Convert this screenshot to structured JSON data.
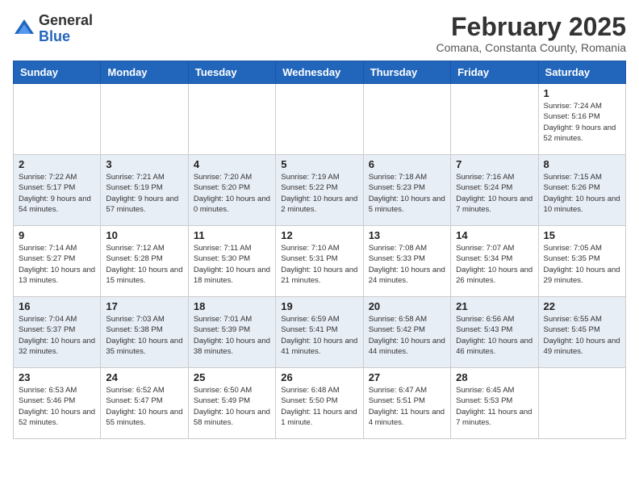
{
  "header": {
    "logo_general": "General",
    "logo_blue": "Blue",
    "month_year": "February 2025",
    "location": "Comana, Constanta County, Romania"
  },
  "weekdays": [
    "Sunday",
    "Monday",
    "Tuesday",
    "Wednesday",
    "Thursday",
    "Friday",
    "Saturday"
  ],
  "weeks": [
    [
      {
        "day": "",
        "info": ""
      },
      {
        "day": "",
        "info": ""
      },
      {
        "day": "",
        "info": ""
      },
      {
        "day": "",
        "info": ""
      },
      {
        "day": "",
        "info": ""
      },
      {
        "day": "",
        "info": ""
      },
      {
        "day": "1",
        "info": "Sunrise: 7:24 AM\nSunset: 5:16 PM\nDaylight: 9 hours and 52 minutes."
      }
    ],
    [
      {
        "day": "2",
        "info": "Sunrise: 7:22 AM\nSunset: 5:17 PM\nDaylight: 9 hours and 54 minutes."
      },
      {
        "day": "3",
        "info": "Sunrise: 7:21 AM\nSunset: 5:19 PM\nDaylight: 9 hours and 57 minutes."
      },
      {
        "day": "4",
        "info": "Sunrise: 7:20 AM\nSunset: 5:20 PM\nDaylight: 10 hours and 0 minutes."
      },
      {
        "day": "5",
        "info": "Sunrise: 7:19 AM\nSunset: 5:22 PM\nDaylight: 10 hours and 2 minutes."
      },
      {
        "day": "6",
        "info": "Sunrise: 7:18 AM\nSunset: 5:23 PM\nDaylight: 10 hours and 5 minutes."
      },
      {
        "day": "7",
        "info": "Sunrise: 7:16 AM\nSunset: 5:24 PM\nDaylight: 10 hours and 7 minutes."
      },
      {
        "day": "8",
        "info": "Sunrise: 7:15 AM\nSunset: 5:26 PM\nDaylight: 10 hours and 10 minutes."
      }
    ],
    [
      {
        "day": "9",
        "info": "Sunrise: 7:14 AM\nSunset: 5:27 PM\nDaylight: 10 hours and 13 minutes."
      },
      {
        "day": "10",
        "info": "Sunrise: 7:12 AM\nSunset: 5:28 PM\nDaylight: 10 hours and 15 minutes."
      },
      {
        "day": "11",
        "info": "Sunrise: 7:11 AM\nSunset: 5:30 PM\nDaylight: 10 hours and 18 minutes."
      },
      {
        "day": "12",
        "info": "Sunrise: 7:10 AM\nSunset: 5:31 PM\nDaylight: 10 hours and 21 minutes."
      },
      {
        "day": "13",
        "info": "Sunrise: 7:08 AM\nSunset: 5:33 PM\nDaylight: 10 hours and 24 minutes."
      },
      {
        "day": "14",
        "info": "Sunrise: 7:07 AM\nSunset: 5:34 PM\nDaylight: 10 hours and 26 minutes."
      },
      {
        "day": "15",
        "info": "Sunrise: 7:05 AM\nSunset: 5:35 PM\nDaylight: 10 hours and 29 minutes."
      }
    ],
    [
      {
        "day": "16",
        "info": "Sunrise: 7:04 AM\nSunset: 5:37 PM\nDaylight: 10 hours and 32 minutes."
      },
      {
        "day": "17",
        "info": "Sunrise: 7:03 AM\nSunset: 5:38 PM\nDaylight: 10 hours and 35 minutes."
      },
      {
        "day": "18",
        "info": "Sunrise: 7:01 AM\nSunset: 5:39 PM\nDaylight: 10 hours and 38 minutes."
      },
      {
        "day": "19",
        "info": "Sunrise: 6:59 AM\nSunset: 5:41 PM\nDaylight: 10 hours and 41 minutes."
      },
      {
        "day": "20",
        "info": "Sunrise: 6:58 AM\nSunset: 5:42 PM\nDaylight: 10 hours and 44 minutes."
      },
      {
        "day": "21",
        "info": "Sunrise: 6:56 AM\nSunset: 5:43 PM\nDaylight: 10 hours and 46 minutes."
      },
      {
        "day": "22",
        "info": "Sunrise: 6:55 AM\nSunset: 5:45 PM\nDaylight: 10 hours and 49 minutes."
      }
    ],
    [
      {
        "day": "23",
        "info": "Sunrise: 6:53 AM\nSunset: 5:46 PM\nDaylight: 10 hours and 52 minutes."
      },
      {
        "day": "24",
        "info": "Sunrise: 6:52 AM\nSunset: 5:47 PM\nDaylight: 10 hours and 55 minutes."
      },
      {
        "day": "25",
        "info": "Sunrise: 6:50 AM\nSunset: 5:49 PM\nDaylight: 10 hours and 58 minutes."
      },
      {
        "day": "26",
        "info": "Sunrise: 6:48 AM\nSunset: 5:50 PM\nDaylight: 11 hours and 1 minute."
      },
      {
        "day": "27",
        "info": "Sunrise: 6:47 AM\nSunset: 5:51 PM\nDaylight: 11 hours and 4 minutes."
      },
      {
        "day": "28",
        "info": "Sunrise: 6:45 AM\nSunset: 5:53 PM\nDaylight: 11 hours and 7 minutes."
      },
      {
        "day": "",
        "info": ""
      }
    ]
  ]
}
